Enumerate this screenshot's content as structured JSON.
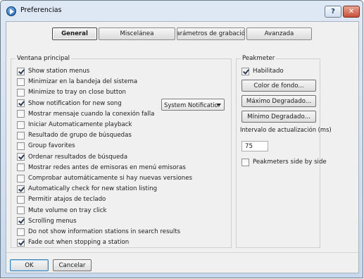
{
  "window": {
    "title": "Preferencias"
  },
  "tabs": [
    {
      "label": "General",
      "active": true
    },
    {
      "label": "Miscelánea",
      "active": false
    },
    {
      "label": "Parámetros de grabación",
      "active": false
    },
    {
      "label": "Avanzada",
      "active": false
    }
  ],
  "main_group": {
    "label": "Ventana principal",
    "options": [
      {
        "label": "Show station menus",
        "checked": true
      },
      {
        "label": "Minimizar en la bandeja del sistema",
        "checked": false
      },
      {
        "label": "Minimize to tray on close button",
        "checked": false
      },
      {
        "label": "Show notification for new song",
        "checked": true
      },
      {
        "label": "Mostrar mensaje cuando la conexión falla",
        "checked": false
      },
      {
        "label": "Iniciar Automaticamente playback",
        "checked": false
      },
      {
        "label": "Resultado de grupo de búsquedas",
        "checked": false
      },
      {
        "label": "Group favorites",
        "checked": false
      },
      {
        "label": "Ordenar resultados de búsqueda",
        "checked": true
      },
      {
        "label": "Mostrar redes antes de emisoras en menú emisoras",
        "checked": false
      },
      {
        "label": "Comprobar automáticamente si hay nuevas versiones",
        "checked": false
      },
      {
        "label": "Automatically check for new station listing",
        "checked": true
      },
      {
        "label": "Permitir atajos de teclado",
        "checked": false
      },
      {
        "label": "Mute volume on tray click",
        "checked": false
      },
      {
        "label": "Scrolling menus",
        "checked": true
      },
      {
        "label": "Do not show information stations in search results",
        "checked": false
      },
      {
        "label": "Fade out when stopping a station",
        "checked": true
      }
    ],
    "notification_select": {
      "value": "System Notificatior"
    }
  },
  "peakmeter": {
    "label": "Peakmeter",
    "enabled": {
      "label": "Habilitado",
      "checked": true
    },
    "background_color_button": "Color de fondo...",
    "max_gradient_button": "Máximo Degradado...",
    "min_gradient_button": "Mínimo Degradado...",
    "interval_label": "Intervalo de actualización (ms)",
    "interval_value": "75",
    "side_by_side": {
      "label": "Peakmeters side by side",
      "checked": false
    }
  },
  "footer": {
    "ok_label": "OK",
    "cancel_label": "Cancelar"
  },
  "colors": {
    "accent": "#3c7fb1",
    "titlebar": "#c8d9ee",
    "close": "#c7503a"
  }
}
